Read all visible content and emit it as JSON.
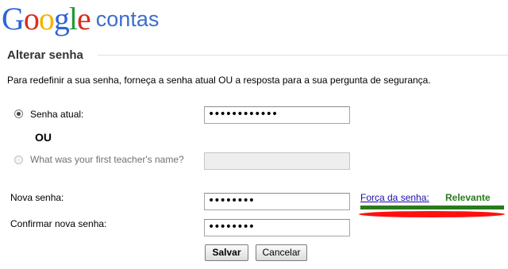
{
  "brand": {
    "logo_letters": [
      {
        "ch": "G",
        "color": "#2f63d8"
      },
      {
        "ch": "o",
        "color": "#d62d20"
      },
      {
        "ch": "o",
        "color": "#f2b400"
      },
      {
        "ch": "g",
        "color": "#2f63d8"
      },
      {
        "ch": "l",
        "color": "#1f9b3a"
      },
      {
        "ch": "e",
        "color": "#d62d20"
      }
    ],
    "product": "contas"
  },
  "section": {
    "title": "Alterar senha",
    "instructions": "Para redefinir a sua senha, forneça a senha atual OU a resposta para a sua pergunta de segurança."
  },
  "form": {
    "current_password": {
      "label": "Senha atual:",
      "value": "••••••••••••",
      "selected": true
    },
    "or_text": "OU",
    "security_question": {
      "label": "What was your first teacher's name?",
      "value": "",
      "selected": false,
      "disabled": true
    },
    "new_password": {
      "label": "Nova senha:",
      "value": "••••••••"
    },
    "confirm_password": {
      "label": "Confirmar nova senha:",
      "value": "••••••••"
    },
    "strength": {
      "link_label": "Força da senha:",
      "value": "Relevante",
      "color": "#2a7a1d",
      "level": 1.0
    }
  },
  "buttons": {
    "save_label": "Salvar",
    "cancel_label": "Cancelar"
  }
}
